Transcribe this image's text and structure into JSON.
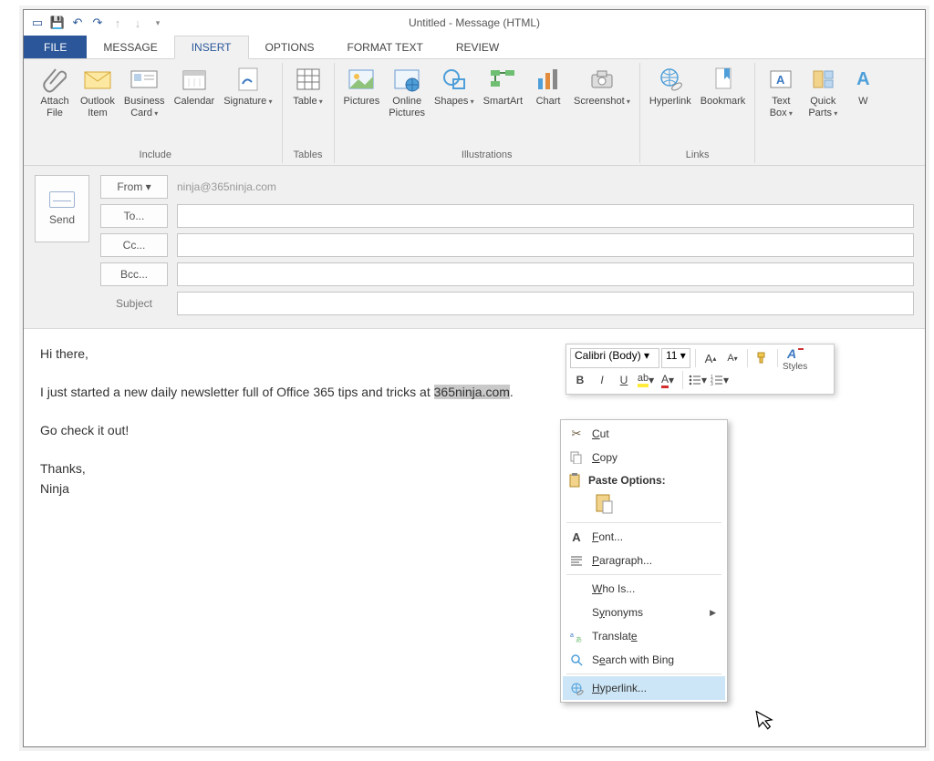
{
  "quick_access": {
    "title": "Untitled - Message (HTML)"
  },
  "tabs": {
    "file": "FILE",
    "message": "MESSAGE",
    "insert": "INSERT",
    "options": "OPTIONS",
    "format_text": "FORMAT TEXT",
    "review": "REVIEW"
  },
  "ribbon": {
    "include": {
      "attach_file": "Attach\nFile",
      "outlook_item": "Outlook\nItem",
      "business_card": "Business\nCard",
      "calendar": "Calendar",
      "signature": "Signature",
      "label": "Include"
    },
    "tables": {
      "table": "Table",
      "label": "Tables"
    },
    "illustrations": {
      "pictures": "Pictures",
      "online_pictures": "Online\nPictures",
      "shapes": "Shapes",
      "smartart": "SmartArt",
      "chart": "Chart",
      "screenshot": "Screenshot",
      "label": "Illustrations"
    },
    "links": {
      "hyperlink": "Hyperlink",
      "bookmark": "Bookmark",
      "label": "Links"
    },
    "text": {
      "text_box": "Text\nBox",
      "quick_parts": "Quick\nParts",
      "wordart": "W"
    }
  },
  "header": {
    "send": "Send",
    "from": "From",
    "from_value": "ninja@365ninja.com",
    "to": "To...",
    "cc": "Cc...",
    "bcc": "Bcc...",
    "subject": "Subject"
  },
  "body": {
    "greet": "Hi there,",
    "line1a": "I just started a new daily newsletter full of Office 365 tips and tricks at ",
    "sel": "365ninja.com",
    "line1b": ".",
    "line2": "Go check it out!",
    "thanks": "Thanks,",
    "sig": "Ninja"
  },
  "mini": {
    "font": "Calibri (Body)",
    "size": "11",
    "styles": "Styles"
  },
  "context": {
    "cut": "Cut",
    "copy": "Copy",
    "paste_options": "Paste Options:",
    "font": "Font...",
    "paragraph": "Paragraph...",
    "who_is": "Who Is...",
    "synonyms": "Synonyms",
    "translate": "Translate",
    "search_bing": "Search with Bing",
    "hyperlink": "Hyperlink..."
  }
}
